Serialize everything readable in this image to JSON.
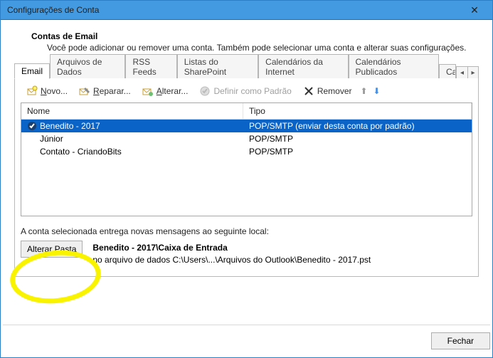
{
  "window": {
    "title": "Configurações de Conta",
    "close_glyph": "✕"
  },
  "header": {
    "title": "Contas de Email",
    "subtitle": "Você pode adicionar ou remover uma conta. Também pode selecionar uma conta e alterar suas configurações."
  },
  "tabs": {
    "items": [
      "Email",
      "Arquivos de Dados",
      "RSS Feeds",
      "Listas do SharePoint",
      "Calendários da Internet",
      "Calendários Publicados",
      "Ca"
    ],
    "active_index": 0,
    "scroll_left": "◂",
    "scroll_right": "▸"
  },
  "toolbar": {
    "new_label": "Novo...",
    "repair_label": "Reparar...",
    "change_label": "Alterar...",
    "set_default_label": "Definir como Padrão",
    "remove_label": "Remover",
    "up_glyph": "⬆",
    "down_glyph": "⬇"
  },
  "table": {
    "col_name": "Nome",
    "col_type": "Tipo",
    "rows": [
      {
        "name": "Benedito - 2017",
        "type": "POP/SMTP (enviar desta conta por padrão)",
        "default": true,
        "selected": true
      },
      {
        "name": "Júnior",
        "type": "POP/SMTP",
        "default": false,
        "selected": false
      },
      {
        "name": "Contato - CriandoBits",
        "type": "POP/SMTP",
        "default": false,
        "selected": false
      }
    ]
  },
  "location": {
    "intro": "A conta selecionada entrega novas mensagens ao seguinte local:",
    "change_folder_btn": "Alterar Pasta",
    "folder_path_bold": "Benedito - 2017\\Caixa de Entrada",
    "file_path": "no arquivo de dados C:\\Users\\...\\Arquivos do Outlook\\Benedito - 2017.pst"
  },
  "footer": {
    "close_btn": "Fechar"
  }
}
